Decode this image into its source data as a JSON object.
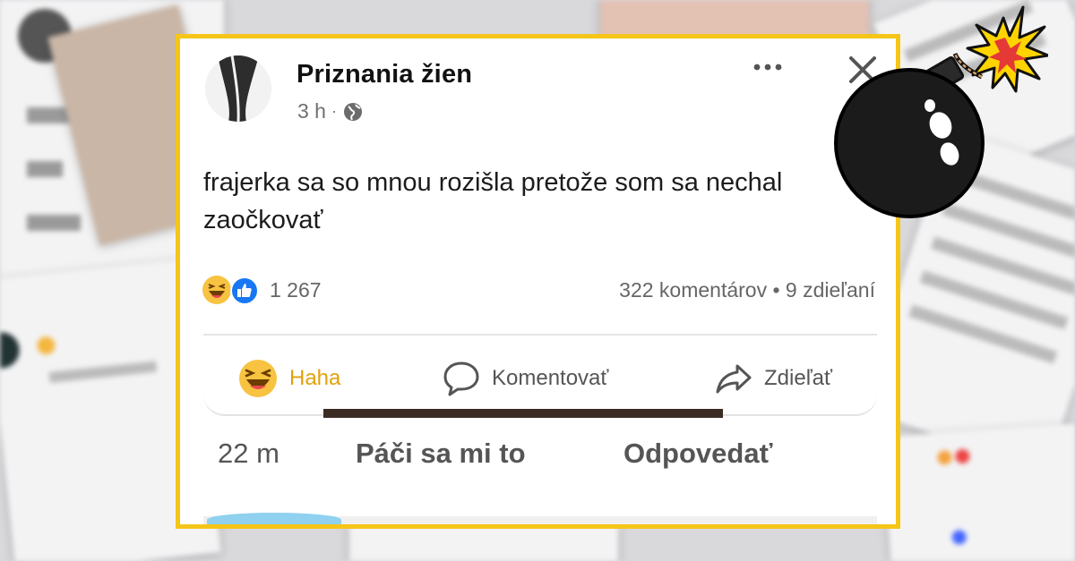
{
  "post": {
    "page_name": "Priznania žien",
    "time": "3 h",
    "meta_separator": "·",
    "text": "frajerka sa so mnou rozišla pretože som sa nechal zaočkovať",
    "reaction_count": "1 267",
    "comments_shares": "322 komentárov • 9 zdieľaní"
  },
  "actions": {
    "haha_label": "Haha",
    "comment_label": "Komentovať",
    "share_label": "Zdieľať"
  },
  "reply_bar": {
    "time": "22 m",
    "like_label": "Páči sa mi to",
    "reply_label": "Odpovedať"
  },
  "colors": {
    "frame": "#f5c518",
    "haha_active": "#e2a10b",
    "like_blue": "#1877f2"
  },
  "icons": [
    "more-icon",
    "close-icon",
    "globe-icon",
    "haha-icon",
    "like-icon",
    "comment-icon",
    "share-icon",
    "bomb-icon"
  ]
}
